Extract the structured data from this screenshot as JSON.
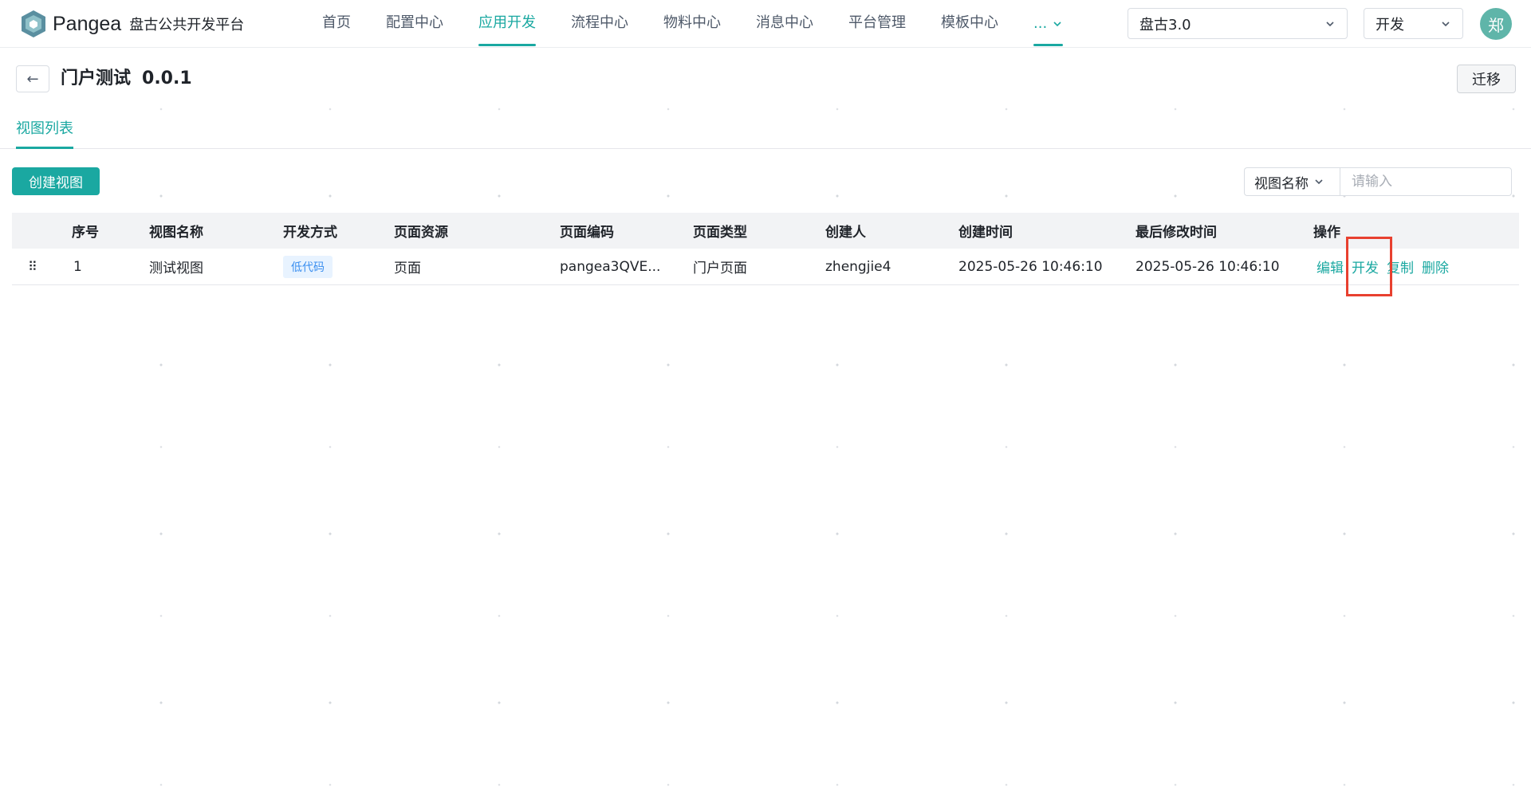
{
  "app": {
    "logo_name": "Pangea",
    "logo_sub": "盘古公共开发平台"
  },
  "nav": {
    "items": [
      {
        "label": "首页"
      },
      {
        "label": "配置中心"
      },
      {
        "label": "应用开发",
        "active": true
      },
      {
        "label": "流程中心"
      },
      {
        "label": "物料中心"
      },
      {
        "label": "消息中心"
      },
      {
        "label": "平台管理"
      },
      {
        "label": "模板中心"
      }
    ],
    "more_label": "..."
  },
  "header_controls": {
    "project_select_value": "盘古3.0",
    "env_select_value": "开发",
    "avatar_text": "郑"
  },
  "page": {
    "title": "门户测试",
    "version": "0.0.1",
    "migrate_label": "迁移",
    "back_icon": "←"
  },
  "tabs": [
    {
      "label": "视图列表",
      "active": true
    }
  ],
  "toolbar": {
    "create_label": "创建视图",
    "search_field": "视图名称",
    "search_placeholder": "请输入"
  },
  "table": {
    "columns": [
      "序号",
      "视图名称",
      "开发方式",
      "页面资源",
      "页面编码",
      "页面类型",
      "创建人",
      "创建时间",
      "最后修改时间",
      "操作"
    ],
    "rows": [
      {
        "index": "1",
        "name": "测试视图",
        "dev_mode": "低代码",
        "resource": "页面",
        "code": "pangea3QVE...",
        "type": "门户页面",
        "creator": "zhengjie4",
        "created": "2025-05-26 10:46:10",
        "modified": "2025-05-26 10:46:10",
        "actions": [
          "编辑",
          "开发",
          "复制",
          "删除"
        ]
      }
    ]
  },
  "colors": {
    "accent": "#1aa8a1",
    "highlight": "#e8402f",
    "tag_bg": "#e8f3ff",
    "tag_text": "#3b8ff0"
  }
}
